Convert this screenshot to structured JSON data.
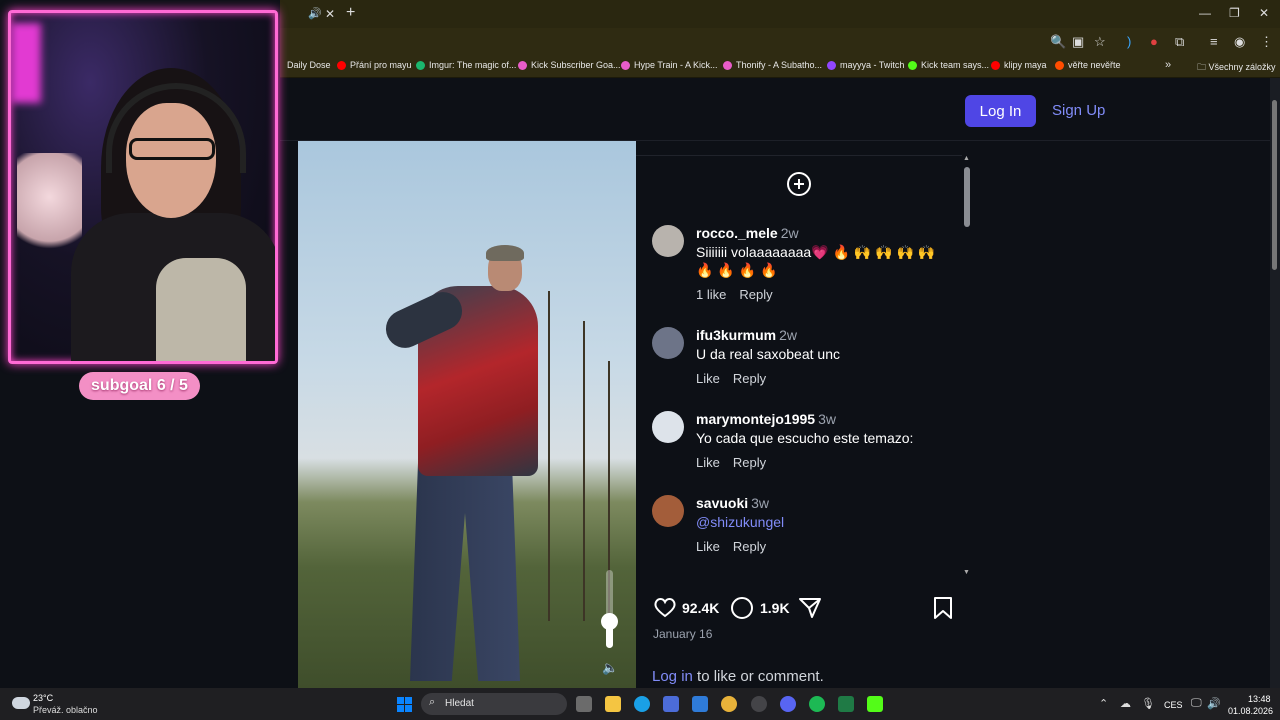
{
  "browser": {
    "tab_speaker_icon": "speaker-icon",
    "tab_close": "✕",
    "new_tab": "+",
    "window_controls": [
      "—",
      "❐",
      "✕"
    ],
    "bookmarks": [
      {
        "label": "Daily Dose",
        "color": "#ffffff"
      },
      {
        "label": "Přání pro mayu",
        "color": "#ff0000"
      },
      {
        "label": "Imgur: The magic of...",
        "color": "#1bb76e"
      },
      {
        "label": "Kick Subscriber Goa...",
        "color": "#e85cc8"
      },
      {
        "label": "Hype Train - A Kick...",
        "color": "#e85cc8"
      },
      {
        "label": "Thonify - A Subatho...",
        "color": "#e85cc8"
      },
      {
        "label": "mayyya - Twitch",
        "color": "#9146ff"
      },
      {
        "label": "Kick team says...",
        "color": "#53fc18"
      },
      {
        "label": "klipy maya",
        "color": "#ff0000"
      },
      {
        "label": "věřte nevěřte",
        "color": "#ff4d00"
      }
    ],
    "bookmarks_overflow": "»",
    "all_bookmarks": "Všechny záložky"
  },
  "header": {
    "login_label": "Log In",
    "signup_label": "Sign Up"
  },
  "comments": [
    {
      "user": "rocco._mele",
      "time": "2w",
      "text": "Siiiiiii volaaaaaaaa💗 🔥 🙌 🙌 🙌 🙌 🔥 🔥 🔥 🔥",
      "likes": "1 like",
      "reply": "Reply",
      "avatar_color": "#b8b3ad"
    },
    {
      "user": "ifu3kurmum",
      "time": "2w",
      "text": "U da real saxobeat unc",
      "likes": "Like",
      "reply": "Reply",
      "avatar_color": "#6d7488"
    },
    {
      "user": "marymontejo1995",
      "time": "3w",
      "text": "Yo cada que escucho este temazo:",
      "likes": "Like",
      "reply": "Reply",
      "avatar_color": "#dde3ea"
    },
    {
      "user": "savuoki",
      "time": "3w",
      "text": "@shizukungel",
      "likes": "Like",
      "reply": "Reply",
      "avatar_color": "#a35d3a"
    }
  ],
  "actions": {
    "likes_count": "92.4K",
    "comments_count": "1.9K",
    "date": "January 16",
    "login_link": "Log in",
    "login_suffix": " to like or comment."
  },
  "video": {
    "volume_level": 0.35
  },
  "overlay": {
    "subgoal": "subgoal  6 / 5"
  },
  "taskbar": {
    "temperature": "23°C",
    "weather": "Převáž. oblačno",
    "search_placeholder": "Hledat",
    "language": "CES",
    "time": "13:48",
    "date": "01.08.2026",
    "apps": [
      {
        "name": "task-view-icon",
        "color": "#6b6b6b"
      },
      {
        "name": "file-explorer-icon",
        "color": "#f4c542"
      },
      {
        "name": "edge-icon",
        "color": "#1aa0e6"
      },
      {
        "name": "store-icon",
        "color": "#4c6cd8"
      },
      {
        "name": "outlook-icon",
        "color": "#2f7bd8"
      },
      {
        "name": "chrome-icon",
        "color": "#e8b23a"
      },
      {
        "name": "obs-icon",
        "color": "#444448"
      },
      {
        "name": "discord-icon",
        "color": "#5865f2"
      },
      {
        "name": "spotify-icon",
        "color": "#1db954"
      },
      {
        "name": "excel-icon",
        "color": "#1f7a45"
      },
      {
        "name": "kick-icon",
        "color": "#53fc18"
      }
    ]
  }
}
